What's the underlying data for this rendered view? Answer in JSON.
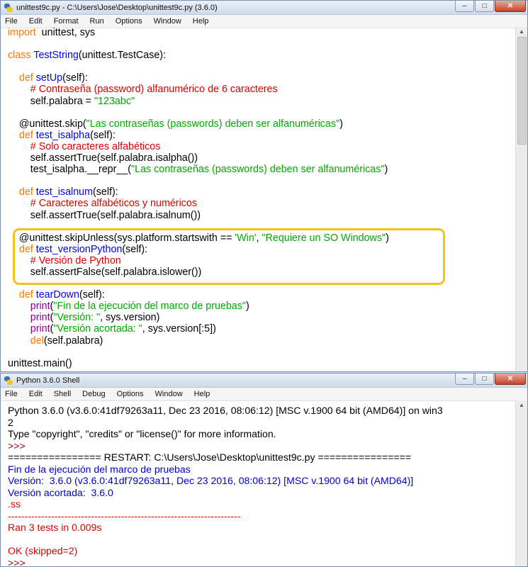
{
  "editor": {
    "title": "unittest9c.py - C:\\Users\\Jose\\Desktop\\unittest9c.py (3.6.0)",
    "menu": [
      "File",
      "Edit",
      "Format",
      "Run",
      "Options",
      "Window",
      "Help"
    ],
    "lines": [
      [
        [
          "kw",
          "import"
        ],
        [
          "",
          "  unittest, sys"
        ]
      ],
      [],
      [
        [
          "kw",
          "class "
        ],
        [
          "def",
          "TestString"
        ],
        [
          "",
          "(unittest.TestCase):"
        ]
      ],
      [],
      [
        [
          "",
          "    "
        ],
        [
          "kw",
          "def "
        ],
        [
          "def",
          "setUp"
        ],
        [
          "",
          "(self):"
        ]
      ],
      [
        [
          "",
          "        "
        ],
        [
          "com",
          "# Contraseña (password) alfanumérico de 6 caracteres"
        ]
      ],
      [
        [
          "",
          "        self.palabra = "
        ],
        [
          "str",
          "\"123abc\""
        ]
      ],
      [],
      [
        [
          "",
          "    @unittest.skip("
        ],
        [
          "str",
          "\"Las contraseñas (passwords) deben ser alfanuméricas\""
        ],
        [
          "",
          ")"
        ]
      ],
      [
        [
          "",
          "    "
        ],
        [
          "kw",
          "def "
        ],
        [
          "def",
          "test_isalpha"
        ],
        [
          "",
          "(self):"
        ]
      ],
      [
        [
          "",
          "        "
        ],
        [
          "com",
          "# Solo caracteres alfabéticos"
        ]
      ],
      [
        [
          "",
          "        self.assertTrue(self.palabra.isalpha())"
        ]
      ],
      [
        [
          "",
          "        test_isalpha.__repr__("
        ],
        [
          "str",
          "\"Las contraseñas (passwords) deben ser alfanuméricas\""
        ],
        [
          "",
          ")"
        ]
      ],
      [],
      [
        [
          "",
          "    "
        ],
        [
          "kw",
          "def "
        ],
        [
          "def",
          "test_isalnum"
        ],
        [
          "",
          "(self):"
        ]
      ],
      [
        [
          "",
          "        "
        ],
        [
          "com",
          "# Caracteres alfabéticos y numéricos"
        ]
      ],
      [
        [
          "",
          "        self.assertTrue(self.palabra.isalnum())"
        ]
      ],
      [],
      [
        [
          "",
          "    @unittest.skipUnless(sys.platform.startswith == "
        ],
        [
          "str",
          "'Win'"
        ],
        [
          "",
          ", "
        ],
        [
          "str",
          "\"Requiere un SO Windows\""
        ],
        [
          "",
          ")"
        ]
      ],
      [
        [
          "",
          "    "
        ],
        [
          "kw",
          "def "
        ],
        [
          "def",
          "test_versionPython"
        ],
        [
          "",
          "(self):"
        ]
      ],
      [
        [
          "",
          "        "
        ],
        [
          "com",
          "# Versión de Python"
        ]
      ],
      [
        [
          "",
          "        self.assertFalse(self.palabra.islower())"
        ]
      ],
      [],
      [
        [
          "",
          "    "
        ],
        [
          "kw",
          "def "
        ],
        [
          "def",
          "tearDown"
        ],
        [
          "",
          "(self):"
        ]
      ],
      [
        [
          "",
          "        "
        ],
        [
          "bi",
          "print"
        ],
        [
          "",
          "("
        ],
        [
          "str",
          "\"Fin de la ejecución del marco de pruebas\""
        ],
        [
          "",
          ")"
        ]
      ],
      [
        [
          "",
          "        "
        ],
        [
          "bi",
          "print"
        ],
        [
          "",
          "("
        ],
        [
          "str",
          "\"Versión: \""
        ],
        [
          "",
          ", sys.version)"
        ]
      ],
      [
        [
          "",
          "        "
        ],
        [
          "bi",
          "print"
        ],
        [
          "",
          "("
        ],
        [
          "str",
          "\"Versión acortada: \""
        ],
        [
          "",
          ", sys.version[:5])"
        ]
      ],
      [
        [
          "",
          "        "
        ],
        [
          "kw",
          "del"
        ],
        [
          "",
          "(self.palabra)"
        ]
      ],
      [],
      [
        [
          "",
          "unittest.main()"
        ]
      ]
    ]
  },
  "shell": {
    "title": "Python 3.6.0 Shell",
    "menu": [
      "File",
      "Edit",
      "Shell",
      "Debug",
      "Options",
      "Window",
      "Help"
    ],
    "lines": [
      [
        [
          "",
          "Python 3.6.0 (v3.6.0:41df79263a11, Dec 23 2016, 08:06:12) [MSC v.1900 64 bit (AMD64)] on win3"
        ]
      ],
      [
        [
          "",
          "2"
        ]
      ],
      [
        [
          "",
          "Type \"copyright\", \"credits\" or \"license()\" for more information."
        ]
      ],
      [
        [
          "prompt",
          ">>> "
        ]
      ],
      [
        [
          "",
          "================ RESTART: C:\\Users\\Jose\\Desktop\\unittest9c.py ================"
        ]
      ],
      [
        [
          "sout",
          "Fin de la ejecución del marco de pruebas"
        ]
      ],
      [
        [
          "sout",
          "Versión:  3.6.0 (v3.6.0:41df79263a11, Dec 23 2016, 08:06:12) [MSC v.1900 64 bit (AMD64)]"
        ]
      ],
      [
        [
          "sout",
          "Versión acortada:  3.6.0"
        ]
      ],
      [
        [
          "serr",
          ".ss"
        ]
      ],
      [
        [
          "serr",
          "----------------------------------------------------------------------"
        ]
      ],
      [
        [
          "serr",
          "Ran 3 tests in 0.009s"
        ]
      ],
      [],
      [
        [
          "serr",
          "OK (skipped=2)"
        ]
      ],
      [
        [
          "prompt",
          ">>> "
        ]
      ]
    ]
  },
  "window_controls": {
    "minimize": "–",
    "maximize": "□",
    "close": "✕"
  }
}
